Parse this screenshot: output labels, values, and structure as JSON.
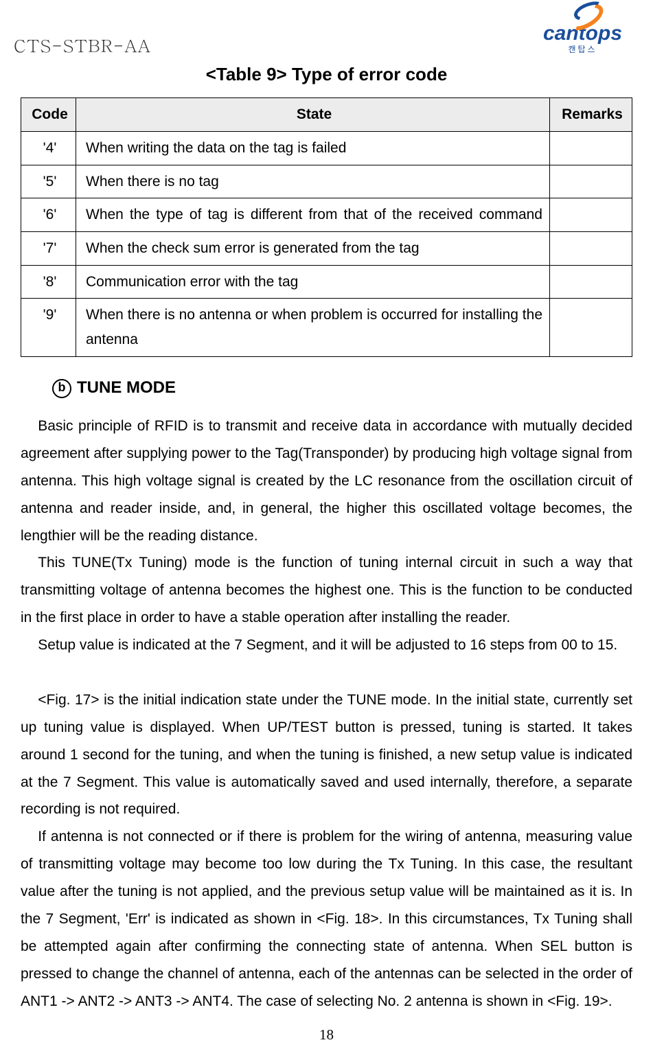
{
  "header": {
    "doc_id": "CTS-STBR-AA",
    "logo_text": "cantops",
    "logo_sub": "캔탑스"
  },
  "table": {
    "caption": "<Table 9> Type of error code",
    "headers": {
      "code": "Code",
      "state": "State",
      "remarks": "Remarks"
    },
    "rows": [
      {
        "code": "'4'",
        "state": "When writing the data on the tag is failed",
        "remarks": "",
        "justify": false
      },
      {
        "code": "'5'",
        "state": "When there is no tag",
        "remarks": "",
        "justify": false
      },
      {
        "code": "'6'",
        "state": "When the type of tag is different from that of the received command",
        "remarks": "",
        "justify": true
      },
      {
        "code": "'7'",
        "state": "When the check sum error is generated from the tag",
        "remarks": "",
        "justify": false
      },
      {
        "code": "'8'",
        "state": "Communication error with the tag",
        "remarks": "",
        "justify": false
      },
      {
        "code": "'9'",
        "state": "When there is no antenna or when problem is occurred for installing the antenna",
        "remarks": "",
        "justify": true
      }
    ]
  },
  "section": {
    "bullet": "b",
    "title": "TUNE MODE"
  },
  "paragraphs": [
    "Basic principle of RFID is to transmit and receive data in accordance with mutually decided agreement after supplying power to the Tag(Transponder) by producing high voltage signal from antenna. This high voltage signal is created by the LC resonance from the oscillation circuit of antenna and reader inside, and, in general, the higher this oscillated voltage becomes, the lengthier will be the reading distance.",
    "This TUNE(Tx Tuning) mode is the function of tuning internal circuit in such a way that transmitting voltage of antenna becomes the highest one. This is the function to be conducted in the first place in order to have a stable operation after installing the reader.",
    "Setup value is indicated at the 7 Segment, and it will be adjusted to 16 steps from 00 to 15.",
    "",
    "<Fig. 17> is the initial indication state under the TUNE mode. In the initial state, currently set up tuning value is displayed. When UP/TEST button is pressed, tuning is started. It takes around 1 second for the tuning, and when the tuning is finished, a new setup value is indicated at the 7 Segment. This value is automatically saved and used internally, therefore, a separate recording is not required.",
    "If antenna is not connected or if there is problem for the wiring of antenna, measuring value of transmitting voltage may become too low during the Tx Tuning. In this case, the resultant value after the tuning is not applied, and the previous setup value will be maintained as it is. In the 7 Segment, 'Err' is indicated as shown in <Fig. 18>. In this circumstances, Tx Tuning shall be attempted again after confirming the connecting state of antenna. When SEL button is pressed to change the channel of antenna, each of the antennas can be selected in the order of ANT1 -> ANT2 -> ANT3 -> ANT4. The case of selecting No. 2 antenna is shown in <Fig. 19>."
  ],
  "page_number": "18"
}
